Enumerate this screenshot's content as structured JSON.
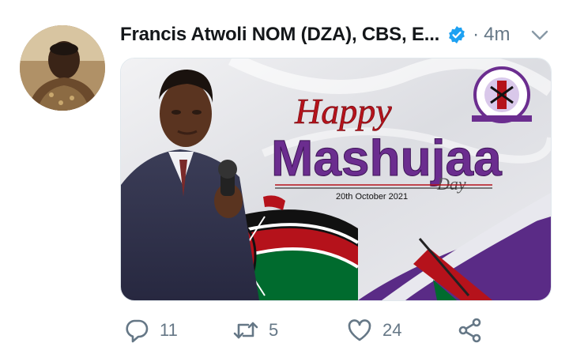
{
  "tweet": {
    "author_name": "Francis Atwoli NOM (DZA), CBS, E...",
    "separator": "·",
    "time": "4m"
  },
  "poster": {
    "happy": "Happy",
    "mashujaa": "Mashujaa",
    "day": "Day",
    "date": "20th October 2021"
  },
  "actions": {
    "replies": "11",
    "retweets": "5",
    "likes": "24"
  },
  "colors": {
    "verified": "#1DA1F2",
    "muted": "#657786",
    "purple": "#6b2d8f",
    "kenya_red": "#b5121b",
    "kenya_green": "#006b2e"
  },
  "icons": [
    "verified-badge-icon",
    "chevron-down-icon",
    "reply-icon",
    "retweet-icon",
    "like-icon",
    "share-icon"
  ]
}
